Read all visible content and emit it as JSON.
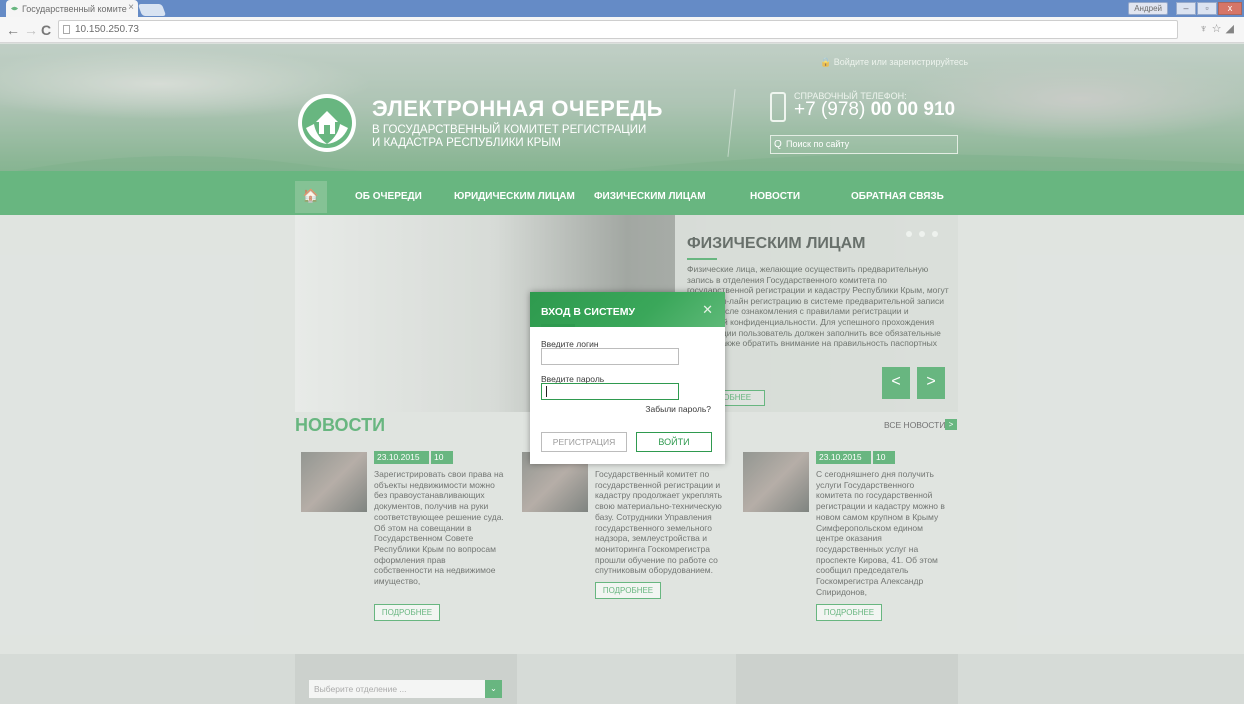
{
  "browser": {
    "tab_title": "Государственный комите",
    "url": "10.150.250.73",
    "user_label": "Андрей",
    "close_tab_glyph": "×",
    "back_glyph": "←",
    "forward_glyph": "→",
    "reload_glyph": "C",
    "extensions_glyphs": "♆☆◢"
  },
  "header": {
    "login_link": "🔒 Войдите или зарегистрируйтесь",
    "title": "ЭЛЕКТРОННАЯ ОЧЕРЕДЬ",
    "subtitle_line1": "В ГОСУДАРСТВЕННЫЙ КОМИТЕТ РЕГИСТРАЦИИ",
    "subtitle_line2": "И КАДАСТРА РЕСПУБЛИКИ КРЫМ",
    "phone_label": "СПРАВОЧНЫЙ ТЕЛЕФОН:",
    "phone_prefix": "+7 (978) ",
    "phone_bold": "00 00 910",
    "search_placeholder": "Поиск по сайту",
    "search_icon_glyph": "Q",
    "logo_icon": "house-hands-icon"
  },
  "nav": {
    "home_icon_glyph": "🏠",
    "items": [
      "ОБ ОЧЕРЕДИ",
      "ЮРИДИЧЕСКИМ ЛИЦАМ",
      "ФИЗИЧЕСКИМ ЛИЦАМ",
      "НОВОСТИ",
      "ОБРАТНАЯ СВЯЗЬ"
    ]
  },
  "slider": {
    "title": "ФИЗИЧЕСКИМ ЛИЦАМ",
    "text": "Физические лица, желающие осуществить предварительную запись в отделения Государственного комитета по государственной регистрации и кадастру Республики Крым, могут пройти он-лайн регистрацию в системе предварительной записи только после ознакомления с правилами регистрации и политикой конфиденциальности. Для успешного прохождения регистрации пользователь должен заполнить все обязательные поля, а также обратить внимание на правильность паспортных данных.",
    "more": "ПОДРОБНЕЕ",
    "prev_glyph": "<",
    "next_glyph": ">"
  },
  "news": {
    "heading": "НОВОСТИ",
    "all_link": "ВСЕ НОВОСТИ",
    "all_link_glyph": ">",
    "items": [
      {
        "date": "23.10.2015",
        "views": "10",
        "text": "Зарегистрировать свои права на объекты недвижимости можно без правоустанавливающих документов, получив на руки соответствующее решение суда. Об этом на совещании в Государственном Совете Республики Крым по вопросам оформления прав собственности на недвижимое имущество,",
        "more": "ПОДРОБНЕЕ"
      },
      {
        "date": "",
        "views": "",
        "text": "Государственный комитет по государственной регистрации и кадастру продолжает укреплять свою материально-техническую базу. Сотрудники Управления государственного земельного надзора, землеустройства и мониторинга Госкомрегистра прошли обучение по работе со спутниковым оборудованием.",
        "more": "ПОДРОБНЕЕ"
      },
      {
        "date": "23.10.2015",
        "views": "10",
        "text": "С сегодняшнего дня получить услуги Государственного комитета по государственной регистрации и кадастру можно в новом самом крупном в Крыму Симферопольском едином центре оказания государственных услуг на проспекте Кирова, 41. Об этом сообщил председатель Госкомрегистра Александр Спиридонов,",
        "more": "ПОДРОБНЕЕ"
      }
    ]
  },
  "footer": {
    "branch_placeholder": "Выберите отделение ...",
    "branch_glyph": "⌄"
  },
  "login_modal": {
    "title": "ВХОД В СИСТЕМУ",
    "close_glyph": "✕",
    "login_label": "Введите логин",
    "login_value": "",
    "password_label": "Введите пароль",
    "password_value": "",
    "forgot": "Забыли пароль?",
    "register": "РЕГИСТРАЦИЯ",
    "submit": "ВОЙТИ"
  },
  "colors": {
    "brand_green": "#2f9a4f",
    "tabstrip_blue": "#2a5fb0"
  }
}
